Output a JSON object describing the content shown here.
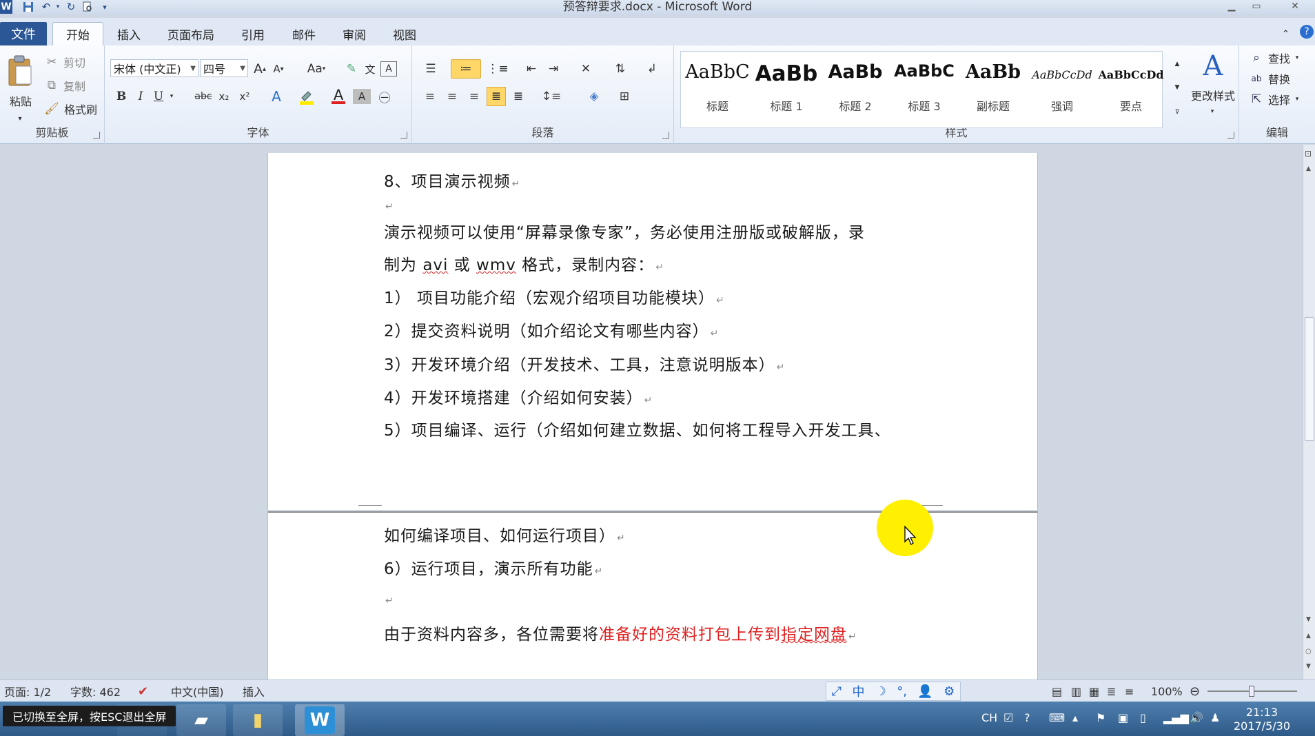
{
  "window": {
    "title": "预答辩要求.docx - Microsoft Word"
  },
  "quick_access": {
    "icons": [
      "word-app-icon",
      "save-icon",
      "undo-icon",
      "redo-icon",
      "print-preview-icon",
      "customize-icon"
    ]
  },
  "ribbon_tabs": {
    "file": "文件",
    "home": "开始",
    "insert": "插入",
    "page_layout": "页面布局",
    "references": "引用",
    "mailings": "邮件",
    "review": "审阅",
    "view": "视图"
  },
  "clipboard": {
    "paste": "粘贴",
    "cut": "剪切",
    "copy": "复制",
    "format_painter": "格式刷",
    "label": "剪贴板"
  },
  "font": {
    "font_name": "宋体 (中文正)",
    "font_size": "四号",
    "grow": "A",
    "shrink": "A",
    "change_case": "Aa",
    "bold": "B",
    "italic": "I",
    "underline": "U",
    "strikethrough": "abc",
    "subscript": "x₂",
    "superscript": "x²",
    "font_color": "A",
    "char_shading": "A",
    "label": "字体"
  },
  "paragraph": {
    "label": "段落"
  },
  "styles": {
    "label": "样式",
    "items": [
      {
        "sample": "AaBbC",
        "name": "标题"
      },
      {
        "sample": "AaBb",
        "name": "标题 1"
      },
      {
        "sample": "AaBb",
        "name": "标题 2"
      },
      {
        "sample": "AaBbC",
        "name": "标题 3"
      },
      {
        "sample": "AaBb",
        "name": "副标题"
      },
      {
        "sample": "AaBbCcDd",
        "name": "强调"
      },
      {
        "sample": "AaBbCcDd",
        "name": "要点"
      }
    ],
    "change_styles": "更改样式"
  },
  "editing": {
    "find": "查找",
    "replace": "替换",
    "select": "选择",
    "label": "编辑"
  },
  "document": {
    "p1": "8、项目演示视频",
    "p2": "演示视频可以使用“屏幕录像专家”，务必使用注册版或破解版，录",
    "p3_a": "制为 ",
    "p3_avi": "avi",
    "p3_b": " 或 ",
    "p3_wmv": "wmv",
    "p3_c": " 格式，录制内容：",
    "item1": "1）   项目功能介绍（宏观介绍项目功能模块）",
    "item2": "2）提交资料说明（如介绍论文有哪些内容）",
    "item3": "3）开发环境介绍（开发技术、工具，注意说明版本）",
    "item4": "4）开发环境搭建（介绍如何安装）",
    "item5": "5）项目编译、运行（介绍如何建立数据、如何将工程导入开发工具、",
    "item5_cont": "如何编译项目、如何运行项目）",
    "item6": "6）运行项目，演示所有功能",
    "last_a": "由于资料内容多，各位需要将",
    "last_red_a": "准备好的资料打包上传到",
    "last_red_b": "指定网盘",
    "para_mark": "↵"
  },
  "status_bar": {
    "page": "页面: 1/2",
    "words": "字数: 462",
    "language": "中文(中国)",
    "mode": "插入",
    "zoom": "100%",
    "ime_mode": "中"
  },
  "taskbar": {
    "toast": "已切换至全屏，按ESC退出全屏",
    "lang": "CH",
    "time": "21:13",
    "date": "2017/5/30"
  },
  "colors": {
    "accent": "#2b5797",
    "highlight_cursor": "#ffef00",
    "red_text": "#e02020"
  }
}
